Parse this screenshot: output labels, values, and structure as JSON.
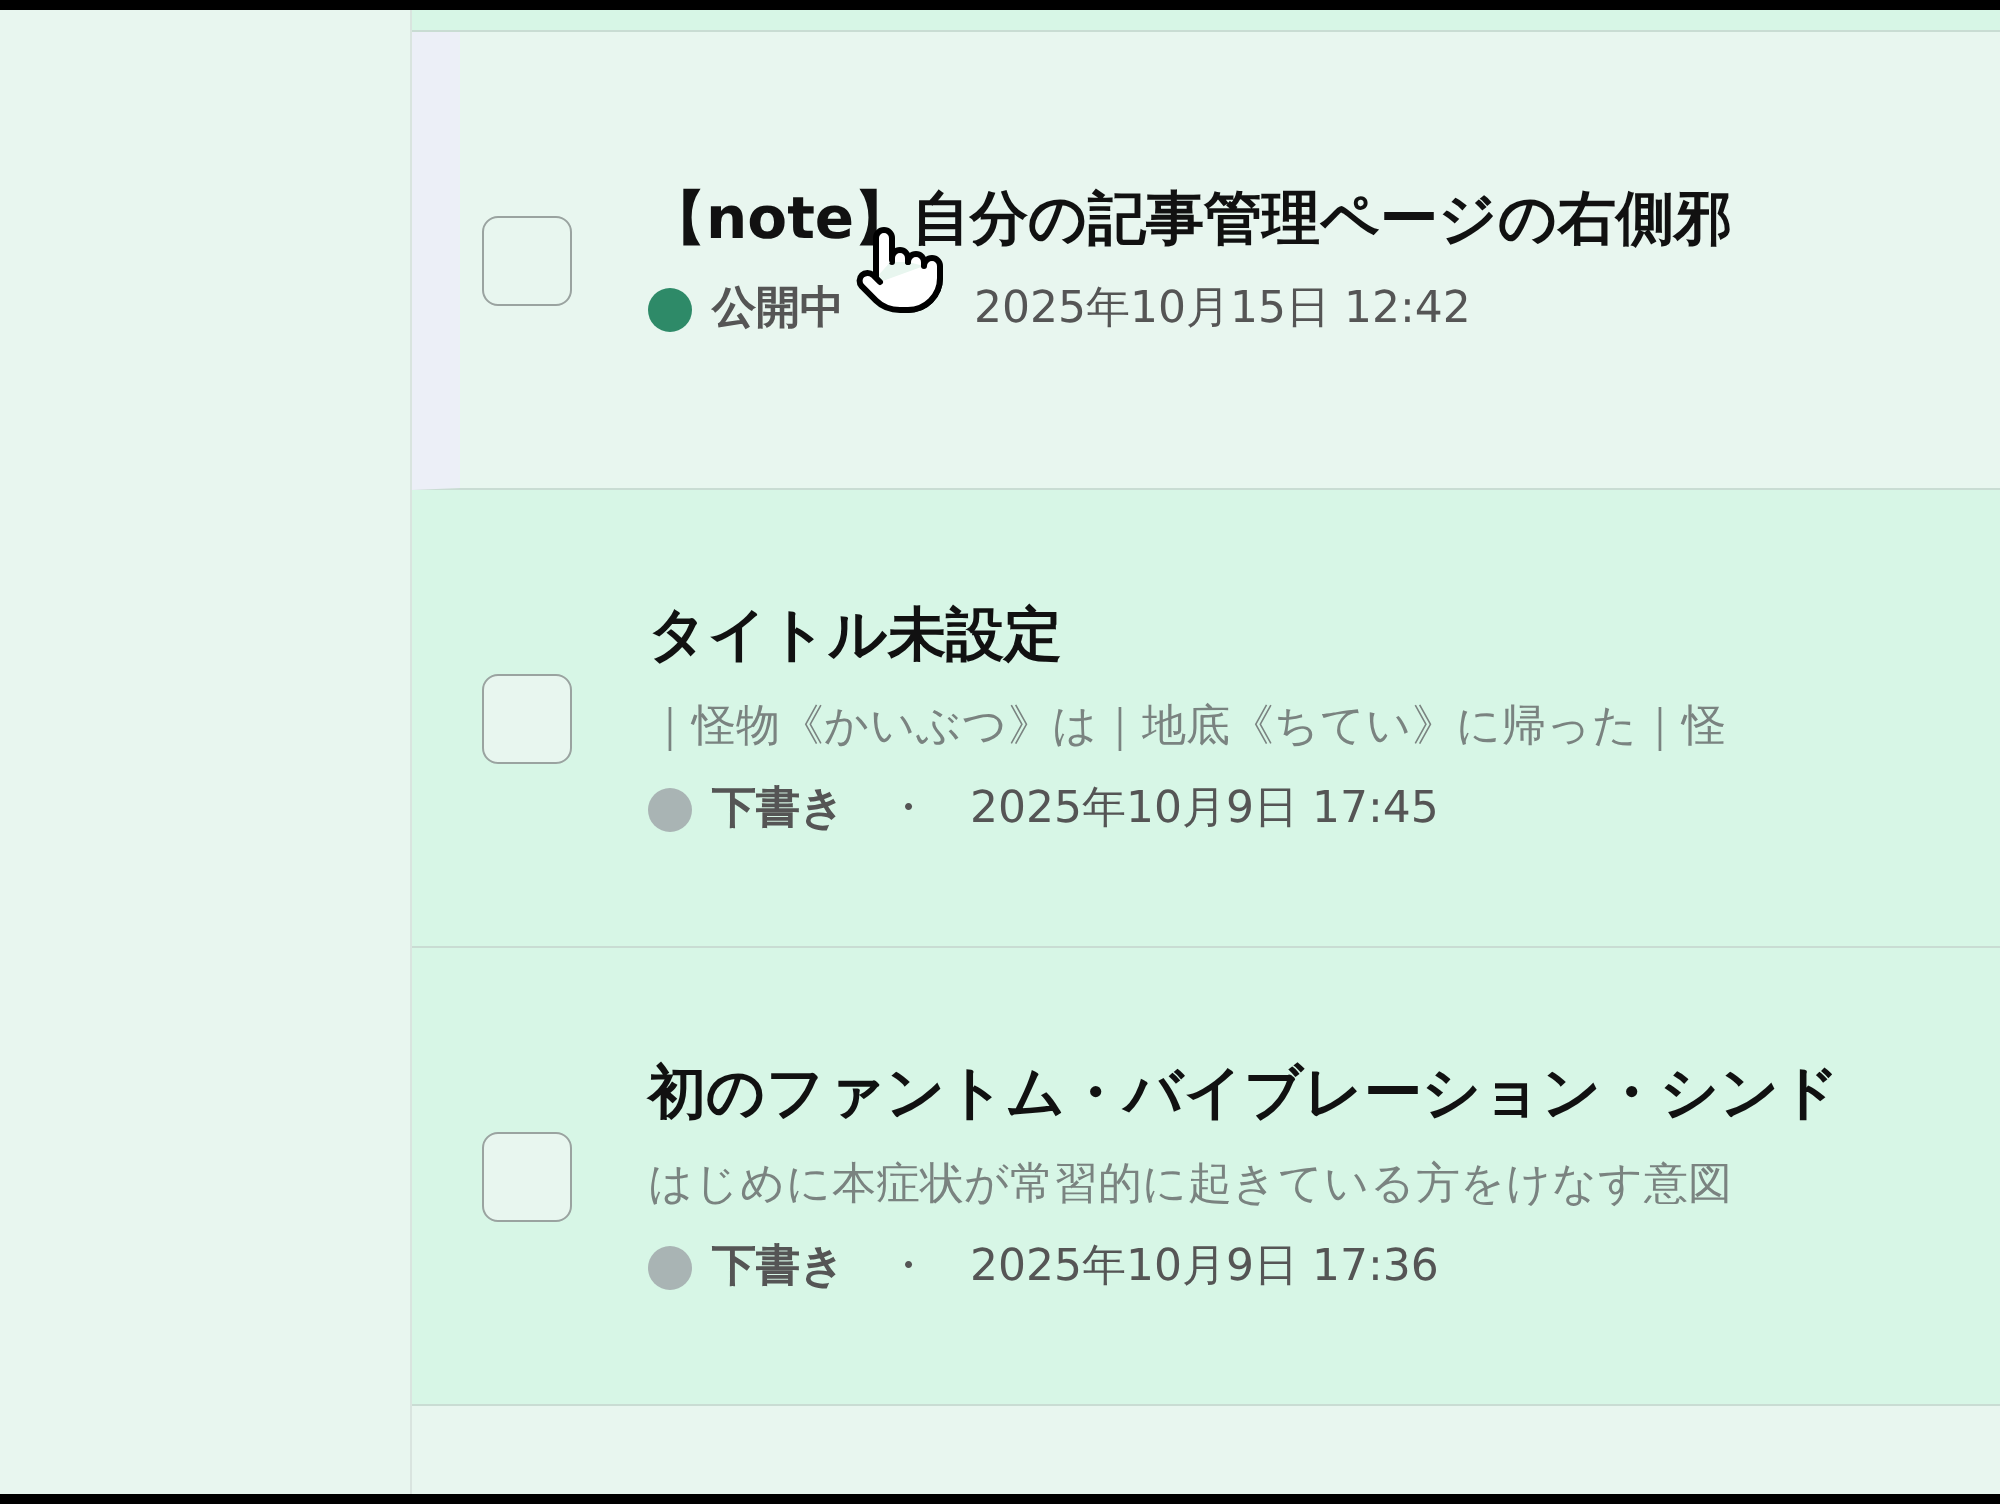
{
  "articles": [
    {
      "title": "【note】自分の記事管理ページの右側邪",
      "status": {
        "kind": "published",
        "label": "公開中"
      },
      "date": "2025年10月15日 12:42",
      "checked": false,
      "hovered": true
    },
    {
      "title": "タイトル未設定",
      "excerpt": "｜怪物《かいぶつ》は｜地底《ちてい》に帰った｜怪",
      "status": {
        "kind": "draft",
        "label": "下書き"
      },
      "separator": "・",
      "date": "2025年10月9日 17:45",
      "checked": false,
      "hovered": false
    },
    {
      "title": "初のファントム・バイブレーション・シンド",
      "excerpt": "はじめに本症状が常習的に起きている方をけなす意図",
      "status": {
        "kind": "draft",
        "label": "下書き"
      },
      "separator": "・",
      "date": "2025年10月9日 17:36",
      "checked": false,
      "hovered": false
    }
  ]
}
